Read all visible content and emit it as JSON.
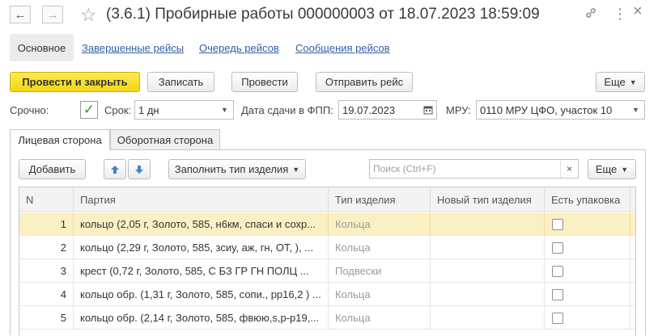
{
  "window": {
    "title": "(3.6.1) Пробирные работы 000000003 от 18.07.2023 18:59:09",
    "icons": [
      "back-arrow-icon",
      "forward-arrow-icon",
      "star-icon",
      "link-icon",
      "more-vert-icon",
      "close-icon"
    ],
    "more_glyph": "⋮",
    "close_glyph": "×"
  },
  "tabs": {
    "main": "Основное",
    "links": [
      "Завершенные рейсы",
      "Очередь рейсов",
      "Сообщения рейсов"
    ]
  },
  "toolbar": {
    "post_close": "Провести и закрыть",
    "save": "Записать",
    "post": "Провести",
    "send": "Отправить рейс",
    "more": "Еще"
  },
  "form": {
    "urgent_label": "Срочно:",
    "urgent_checked": true,
    "term_label": "Срок:",
    "term_value": "1 дн",
    "date_label": "Дата сдачи в ФПП:",
    "date_value": "19.07.2023",
    "mru_label": "МРУ:",
    "mru_value": "0110 МРУ ЦФО, участок 10"
  },
  "inner_tabs": [
    "Лицевая сторона",
    "Оборотная сторона"
  ],
  "table_toolbar": {
    "add": "Добавить",
    "fill": "Заполнить тип изделия",
    "search_placeholder": "Поиск (Ctrl+F)",
    "clear_glyph": "×",
    "more": "Еще"
  },
  "table": {
    "columns": [
      "N",
      "Партия",
      "Тип изделия",
      "Новый тип изделия",
      "Есть упаковка"
    ],
    "rows": [
      {
        "n": "1",
        "party": "кольцо (2,05 г, Золото, 585, н6км, спаси и сохр...",
        "type": "Кольца",
        "new_type": "",
        "packed": false,
        "selected": true
      },
      {
        "n": "2",
        "party": "кольцо (2,29 г, Золото, 585, зсиу, аж, гн, ОТ, ), ...",
        "type": "Кольца",
        "new_type": "",
        "packed": false,
        "selected": false
      },
      {
        "n": "3",
        "party": "крест (0,72 г, Золото, 585, С БЗ ГР ГН ПОЛЦ  ...",
        "type": "Подвески",
        "new_type": "",
        "packed": false,
        "selected": false
      },
      {
        "n": "4",
        "party": "кольцо обр. (1,31 г, Золото, 585, сопи., рр16,2 ) ...",
        "type": "Кольца",
        "new_type": "",
        "packed": false,
        "selected": false
      },
      {
        "n": "5",
        "party": "кольцо обр. (2,14 г, Золото, 585, фвюю,s,р-р19,...",
        "type": "Кольца",
        "new_type": "",
        "packed": false,
        "selected": false
      }
    ]
  },
  "colors": {
    "primary_button": "#f4d614",
    "link": "#2e5ea8",
    "selected_row": "#fbf0c4",
    "check": "#3a9a22"
  }
}
